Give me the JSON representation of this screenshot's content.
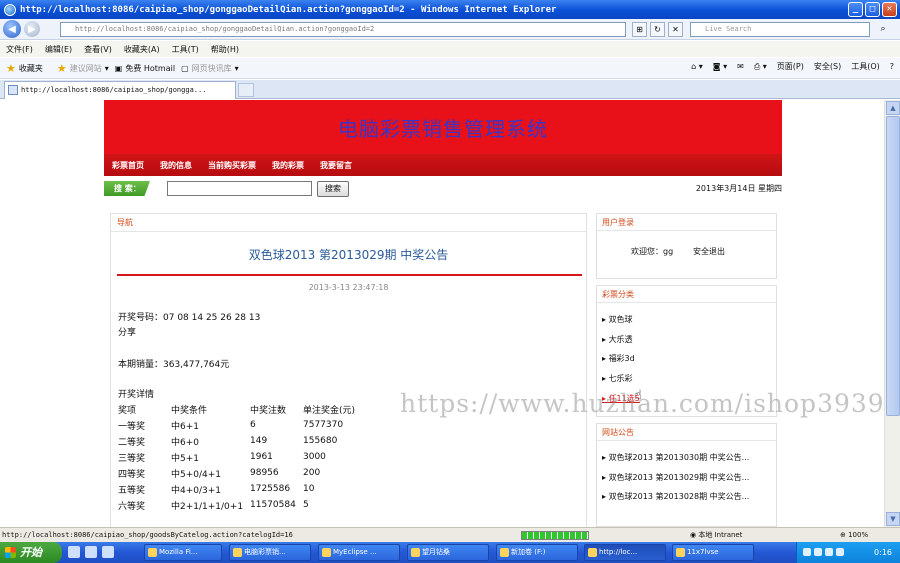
{
  "window": {
    "title": "http://localhost:8086/caipiao_shop/gonggaoDetailQian.action?gonggaoId=2 - Windows Internet Explorer",
    "minimize": "_",
    "maximize": "□",
    "close": "✕"
  },
  "address_bar": {
    "url": "http://localhost:8086/caipiao_shop/gonggaoDetailQian.action?gonggaoId=2",
    "search_placeholder": "Live Search"
  },
  "menu": [
    "文件(F)",
    "编辑(E)",
    "查看(V)",
    "收藏夹(A)",
    "工具(T)",
    "帮助(H)"
  ],
  "favorites_bar": {
    "favorites": "收藏夹",
    "suggested": "建议网站",
    "hotmail": "免费 Hotmail",
    "web_slice": "网页快讯库",
    "page": "页面(P)",
    "safety": "安全(S)",
    "tools": "工具(O)"
  },
  "tab": {
    "title": "http://localhost:8086/caipiao_shop/gongga..."
  },
  "site": {
    "banner_title": "电脑彩票销售管理系统",
    "nav": [
      "彩票首页",
      "我的信息",
      "当前购买彩票",
      "我的彩票",
      "我要留言"
    ],
    "search_label": "搜 索：",
    "search_button": "搜索",
    "date": "2013年3月14日 星期四"
  },
  "notice": {
    "panel_title": "导航",
    "title": "双色球2013 第2013029期 中奖公告",
    "time": "2013-3-13 23:47:18",
    "numbers_line": "开奖号码：07 08 14 25 26 28 13",
    "share": "分享",
    "sales_line": "本期销量：363,477,764元",
    "details_title": "开奖详情",
    "table_header": [
      "奖项",
      "中奖条件",
      "中奖注数",
      "单注奖金(元)"
    ],
    "rows": [
      [
        "一等奖",
        "中6+1",
        "6",
        "7577370"
      ],
      [
        "二等奖",
        "中6+0",
        "149",
        "155680"
      ],
      [
        "三等奖",
        "中5+1",
        "1961",
        "3000"
      ],
      [
        "四等奖",
        "中5+0/4+1",
        "98956",
        "200"
      ],
      [
        "五等奖",
        "中4+0/3+1",
        "1725586",
        "10"
      ],
      [
        "六等奖",
        "中2+1/1+1/0+1",
        "11570584",
        "5"
      ]
    ]
  },
  "login_box": {
    "title": "用户登录",
    "welcome": "欢迎您：gg",
    "logout": "安全退出"
  },
  "categories": {
    "title": "彩票分类",
    "items": [
      "双色球",
      "大乐透",
      "福彩3d",
      "七乐彩",
      "任11选5"
    ]
  },
  "announcements": {
    "title": "网站公告",
    "items": [
      "双色球2013 第2013030期 中奖公告...",
      "双色球2013 第2013029期 中奖公告...",
      "双色球2013 第2013028期 中奖公告..."
    ]
  },
  "watermark": "https://www.huzhan.com/ishop39397",
  "status": {
    "url": "http://localhost:8086/caipiao_shop/goodsByCatelog.action?catelogId=16",
    "zone": "本地 Intranet",
    "zoom": "100%",
    "progress": 1.0
  },
  "taskbar": {
    "start": "开始",
    "tasks": [
      "Mozilla Fi...",
      "电脑彩票销...",
      "MyEclipse ...",
      "望月钻桑",
      "新加卷 (F:)",
      "http://loc...",
      "11x7lvse"
    ],
    "clock": "0:16"
  },
  "colors": {
    "banner_red": "#e8111a",
    "nav_red": "#c4111a",
    "title_blue": "#3a35c8",
    "section_orange": "#d04a1a"
  }
}
